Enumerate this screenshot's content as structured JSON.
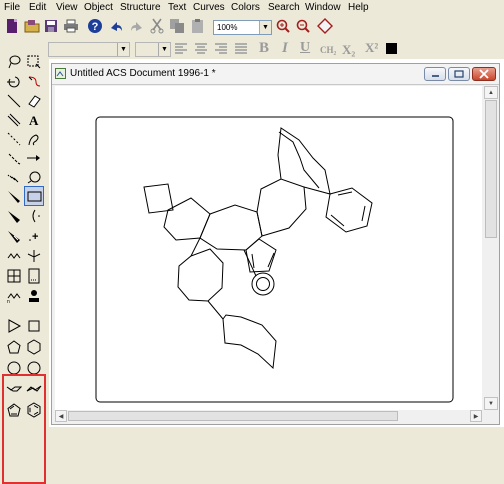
{
  "menu": [
    "File",
    "Edit",
    "View",
    "Object",
    "Structure",
    "Text",
    "Curves",
    "Colors",
    "Search",
    "Window",
    "Help"
  ],
  "toolbar": {
    "zoom_value": "100%",
    "icons": [
      "new-document",
      "open-folder",
      "save",
      "print",
      "help",
      "undo",
      "redo",
      "cut",
      "copy",
      "paste",
      "zoom-select",
      "zoom-in",
      "zoom-out",
      "fit-diamond"
    ]
  },
  "format_toolbar": {
    "font_value": "",
    "size_value": "",
    "bold": "B",
    "italic": "I",
    "underline": "U",
    "formula": "CH₂",
    "subscript": "X₂",
    "superscript": "X²"
  },
  "document": {
    "title": "Untitled ACS Document 1996-1 *"
  },
  "colors": {
    "highlight": "#e03030",
    "selected_tool": "#316ac5",
    "toolbar_bg": "#ece9d8"
  }
}
